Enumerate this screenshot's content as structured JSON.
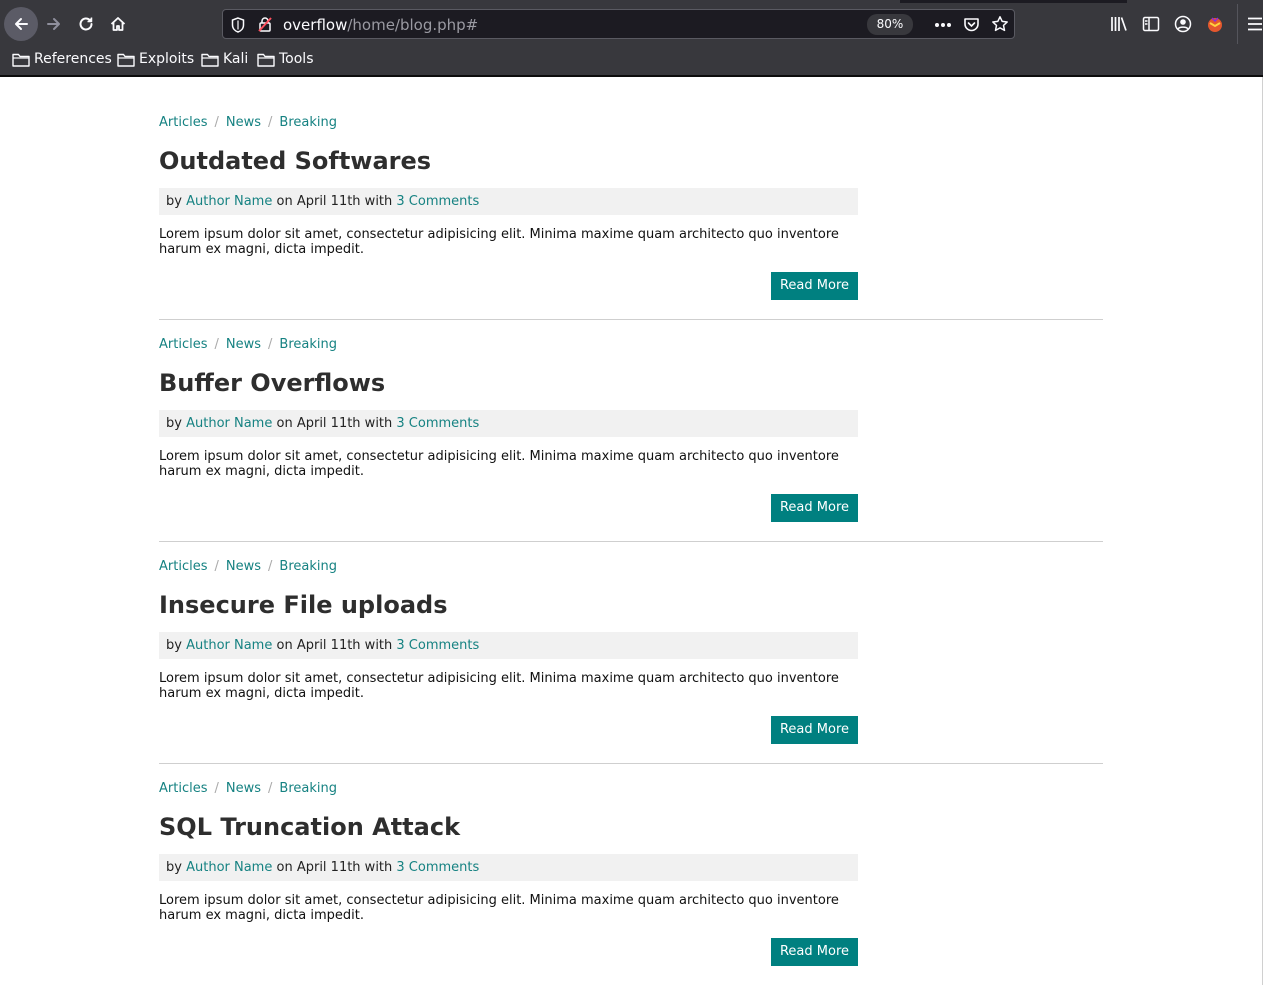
{
  "browser": {
    "url_host": "overflow",
    "url_path": "/home/blog.php#",
    "zoom": "80%",
    "bookmarks": [
      "References",
      "Exploits",
      "Kali",
      "Tools"
    ]
  },
  "posts": [
    {
      "crumbs": [
        "Articles",
        "News",
        "Breaking"
      ],
      "title": "Outdated Softwares",
      "meta": {
        "by": "by",
        "author": "Author Name",
        "date_text": "on April 11th with",
        "comments": "3 Comments"
      },
      "excerpt": "Lorem ipsum dolor sit amet, consectetur adipisicing elit. Minima maxime quam architecto quo inventore harum ex magni, dicta impedit.",
      "button": "Read More"
    },
    {
      "crumbs": [
        "Articles",
        "News",
        "Breaking"
      ],
      "title": "Buffer Overflows",
      "meta": {
        "by": "by",
        "author": "Author Name",
        "date_text": "on April 11th with",
        "comments": "3 Comments"
      },
      "excerpt": "Lorem ipsum dolor sit amet, consectetur adipisicing elit. Minima maxime quam architecto quo inventore harum ex magni, dicta impedit.",
      "button": "Read More"
    },
    {
      "crumbs": [
        "Articles",
        "News",
        "Breaking"
      ],
      "title": "Insecure File uploads",
      "meta": {
        "by": "by",
        "author": "Author Name",
        "date_text": "on April 11th with",
        "comments": "3 Comments"
      },
      "excerpt": "Lorem ipsum dolor sit amet, consectetur adipisicing elit. Minima maxime quam architecto quo inventore harum ex magni, dicta impedit.",
      "button": "Read More"
    },
    {
      "crumbs": [
        "Articles",
        "News",
        "Breaking"
      ],
      "title": "SQL Truncation Attack",
      "meta": {
        "by": "by",
        "author": "Author Name",
        "date_text": "on April 11th with",
        "comments": "3 Comments"
      },
      "excerpt": "Lorem ipsum dolor sit amet, consectetur adipisicing elit. Minima maxime quam architecto quo inventore harum ex magni, dicta impedit.",
      "button": "Read More"
    }
  ],
  "colors": {
    "accent": "#008080",
    "link": "#168282",
    "chrome": "#38383d"
  }
}
